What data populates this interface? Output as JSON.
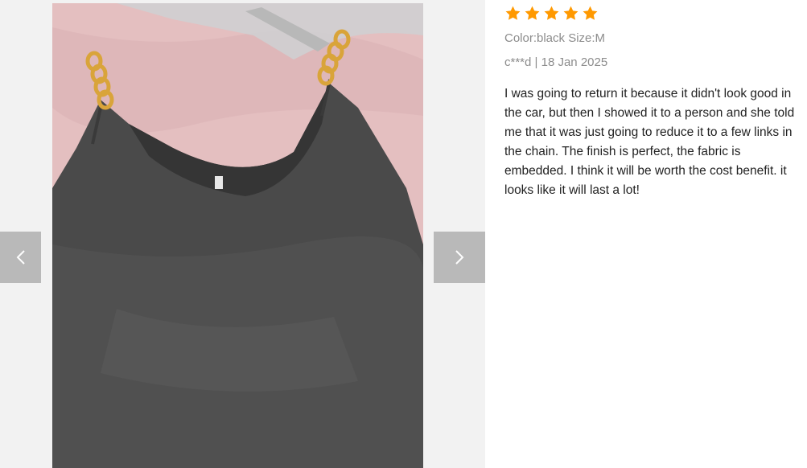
{
  "review": {
    "rating": 5,
    "max_rating": 5,
    "variant": "Color:black Size:M",
    "author": "c***d",
    "separator": "|",
    "date": "18 Jan 2025",
    "text": "I was going to return it because it didn't look good in the car, but then I showed it to a person and she told me that it was just going to reduce it to a few links in the chain. The finish is perfect, the fabric is embedded. I think it will be worth the cost benefit. it looks like it will last a lot!"
  },
  "gallery": {
    "prev_icon": "chevron-left-icon",
    "next_icon": "chevron-right-icon"
  },
  "colors": {
    "star": "#ff9900",
    "meta_text": "#8c8c8c",
    "body_text": "#222222",
    "nav_button": "#b5b5b5"
  }
}
